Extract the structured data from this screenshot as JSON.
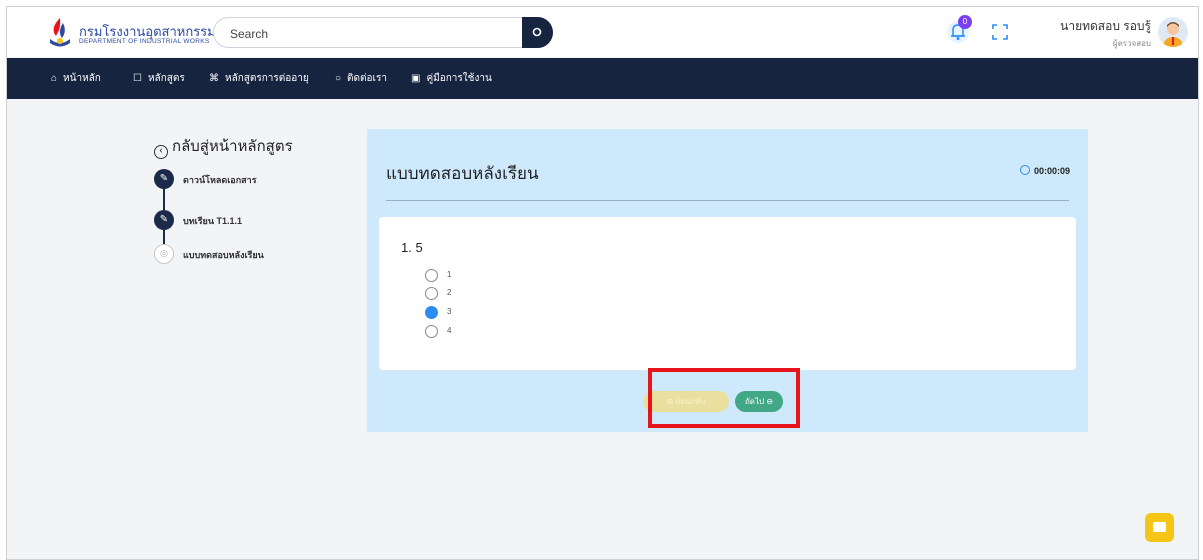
{
  "header": {
    "logo_th": "กรมโรงงานอุตสาหกรรม",
    "logo_en": "DEPARTMENT OF INDUSTRIAL WORKS",
    "search_placeholder": "Search",
    "notification_count": "0",
    "user_name": "นายทดสอบ รอบรู้",
    "user_role": "ผู้ตรวจสอบ"
  },
  "nav": {
    "items": [
      {
        "icon": "home-icon",
        "label": "หน้าหลัก"
      },
      {
        "icon": "book-icon",
        "label": "หลักสูตร"
      },
      {
        "icon": "command-icon",
        "label": "หลักสูตรการต่ออายุ"
      },
      {
        "icon": "chat-icon",
        "label": "ติดต่อเรา"
      },
      {
        "icon": "manual-icon",
        "label": "คู่มือการใช้งาน"
      }
    ]
  },
  "sidebar": {
    "back_label": "กลับสู่หน้าหลักสูตร",
    "steps": [
      {
        "label": "ดาวน์โหลดเอกสาร",
        "status": "done"
      },
      {
        "label": "บทเรียน T1.1.1",
        "status": "done"
      },
      {
        "label": "แบบทดสอบหลังเรียน",
        "status": "current"
      }
    ]
  },
  "quiz": {
    "title": "แบบทดสอบหลังเรียน",
    "timer": "00:00:09",
    "question": "1. 5",
    "options": [
      "1",
      "2",
      "3",
      "4"
    ],
    "selected_option": "3",
    "prev_label": "ย้อนกลับ",
    "next_label": "ถัดไป"
  },
  "colors": {
    "navbar": "#172440",
    "panel": "#cde9fb",
    "next_button": "#41a785",
    "prev_button": "#e9e0a0",
    "highlight": "#e8141b",
    "radio_selected": "#2d8cf0",
    "chat_button": "#f5c518"
  }
}
